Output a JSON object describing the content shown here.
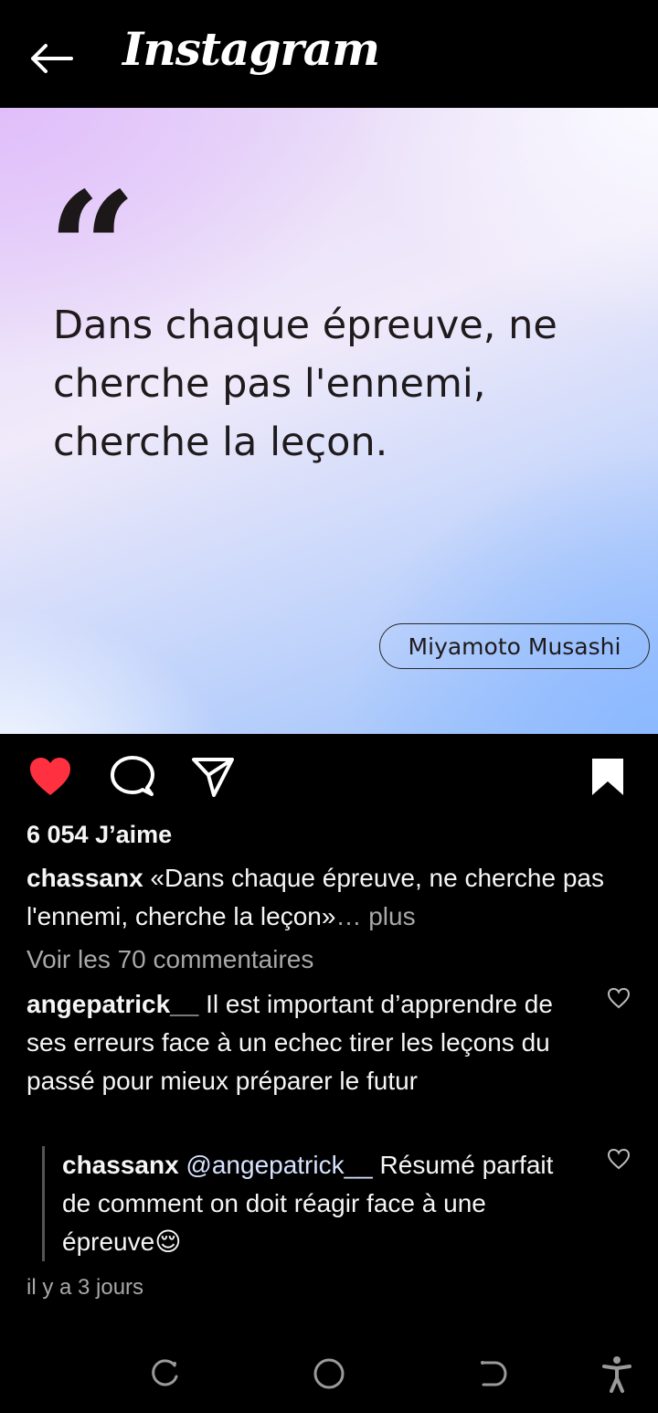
{
  "header": {
    "title": "Instagram",
    "back_icon": "arrow-left-icon"
  },
  "post": {
    "quote_mark": "“",
    "quote_text": "Dans chaque épreuve, ne cherche pas l'ennemi, cherche la leçon.",
    "author": "Miyamoto Musashi",
    "liked": true
  },
  "actions": {
    "like_icon": "heart-filled-icon",
    "comment_icon": "comment-icon",
    "share_icon": "send-icon",
    "save_icon": "bookmark-filled-icon"
  },
  "likes": "6 054 J’aime",
  "caption": {
    "username": "chassanx",
    "text": "«Dans chaque épreuve, ne cherche pas l'ennemi, cherche la leçon»",
    "ellipsis": "…",
    "more": "plus"
  },
  "view_comments": "Voir les 70 commentaires",
  "comments": [
    {
      "username": "angepatrick__",
      "text": "Il est important d’apprendre de ses erreurs face à un echec tirer les leçons du passé pour mieux préparer le futur"
    }
  ],
  "reply": {
    "username": "chassanx",
    "mention": "@angepatrick__",
    "text": "Résumé parfait de comment on doit réagir face à une épreuve",
    "emoji": "😌"
  },
  "timestamp": "il y a 3 jours",
  "colors": {
    "like_red": "#ff3040",
    "background": "#000000",
    "muted_text": "#a8a8a8"
  },
  "system_nav": {
    "recents_icon": "recents-icon",
    "home_icon": "home-circle-icon",
    "back_icon": "system-back-icon",
    "accessibility_icon": "accessibility-icon"
  }
}
